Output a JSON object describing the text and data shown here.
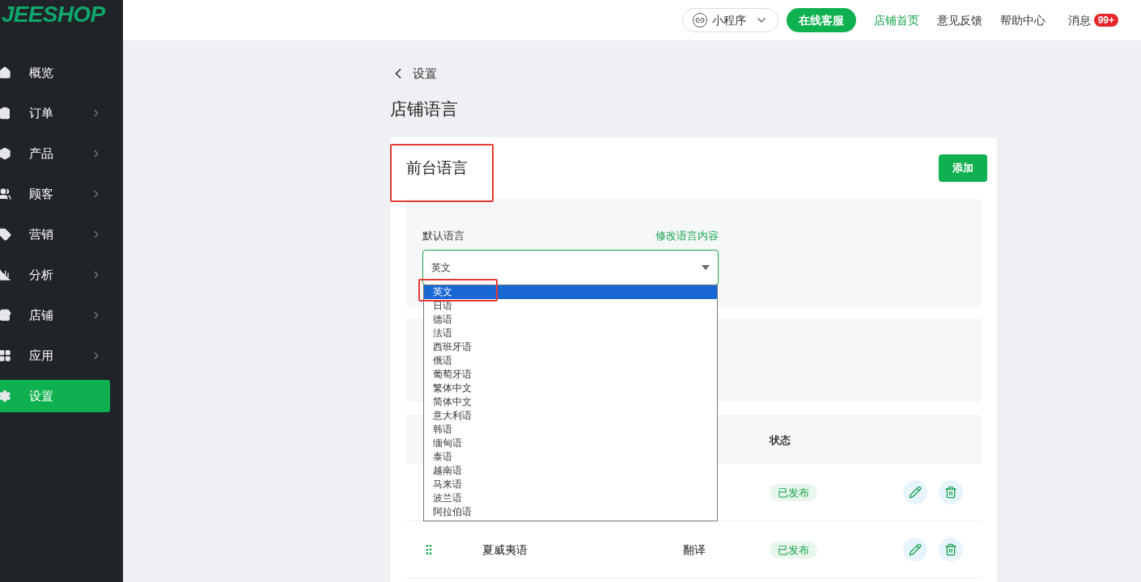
{
  "logo": "JEESHOP",
  "sidebar": {
    "items": [
      {
        "label": "概览",
        "has_children": false,
        "selected": false
      },
      {
        "label": "订单",
        "has_children": true,
        "selected": false
      },
      {
        "label": "产品",
        "has_children": true,
        "selected": false
      },
      {
        "label": "顾客",
        "has_children": true,
        "selected": false
      },
      {
        "label": "营销",
        "has_children": true,
        "selected": false
      },
      {
        "label": "分析",
        "has_children": true,
        "selected": false
      },
      {
        "label": "店铺",
        "has_children": true,
        "selected": false
      },
      {
        "label": "应用",
        "has_children": true,
        "selected": false
      },
      {
        "label": "设置",
        "has_children": false,
        "selected": true
      }
    ]
  },
  "header": {
    "mini_program": "小程序",
    "service_button": "在线客服",
    "links": [
      {
        "label": "店铺首页",
        "selected": true
      },
      {
        "label": "意见反馈",
        "selected": false
      },
      {
        "label": "帮助中心",
        "selected": false
      }
    ],
    "messages": {
      "label": "消息",
      "badge": "99+"
    }
  },
  "breadcrumb": "设置",
  "page_title": "店铺语言",
  "card": {
    "title": "前台语言",
    "add_button": "添加",
    "default_language": {
      "label": "默认语言",
      "link": "修改语言内容",
      "value": "英文",
      "dropdown_open": true,
      "options": [
        {
          "label": "英文",
          "selected": true
        },
        {
          "label": "日语",
          "selected": false
        },
        {
          "label": "德语",
          "selected": false
        },
        {
          "label": "法语",
          "selected": false
        },
        {
          "label": "西班牙语",
          "selected": false
        },
        {
          "label": "俄语",
          "selected": false
        },
        {
          "label": "葡萄牙语",
          "selected": false
        },
        {
          "label": "繁体中文",
          "selected": false
        },
        {
          "label": "简体中文",
          "selected": false
        },
        {
          "label": "意大利语",
          "selected": false
        },
        {
          "label": "韩语",
          "selected": false
        },
        {
          "label": "缅甸语",
          "selected": false
        },
        {
          "label": "泰语",
          "selected": false
        },
        {
          "label": "越南语",
          "selected": false
        },
        {
          "label": "马来语",
          "selected": false
        },
        {
          "label": "波兰语",
          "selected": false
        },
        {
          "label": "阿拉伯语",
          "selected": false
        }
      ]
    },
    "table": {
      "status_header": "状态",
      "rows": [
        {
          "status": "已发布"
        },
        {
          "name": "夏威夷语",
          "action": "翻译",
          "status": "已发布"
        }
      ]
    }
  }
}
